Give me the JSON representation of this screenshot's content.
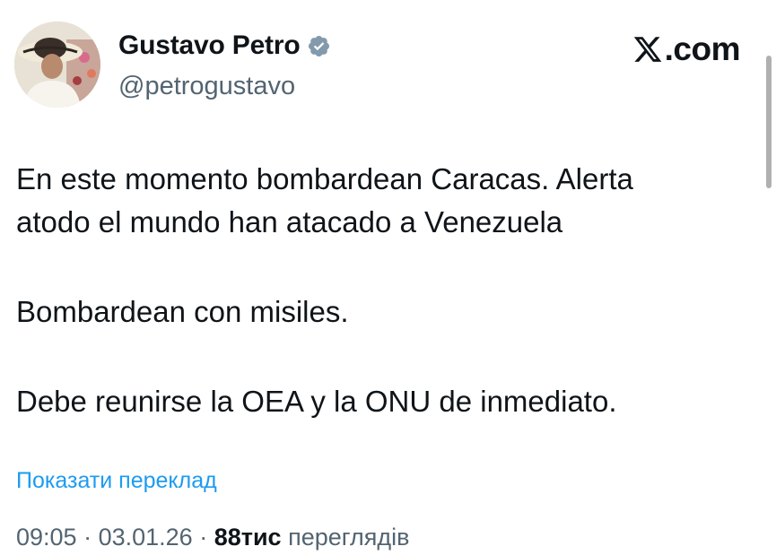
{
  "author": {
    "display_name": "Gustavo Petro",
    "handle": "@petrogustavo",
    "verified": true
  },
  "brand": {
    "domain": ".com",
    "icon": "x-logo-icon"
  },
  "tweet": {
    "paragraphs": [
      "En este momento bombardean Caracas. Alerta atodo el mundo han atacado a Venezuela",
      "Bombardean con misiles.",
      "Debe reunirse la OEA y la ONU de inmediato."
    ],
    "translate_label": "Показати переклад"
  },
  "meta": {
    "time": "09:05",
    "separator": " · ",
    "date": "03.01.26",
    "views_count": "88тис",
    "views_label": "переглядів"
  },
  "colors": {
    "text": "#0f1419",
    "secondary": "#536471",
    "link": "#1d9bf0",
    "verified_badge": "#829aab"
  }
}
